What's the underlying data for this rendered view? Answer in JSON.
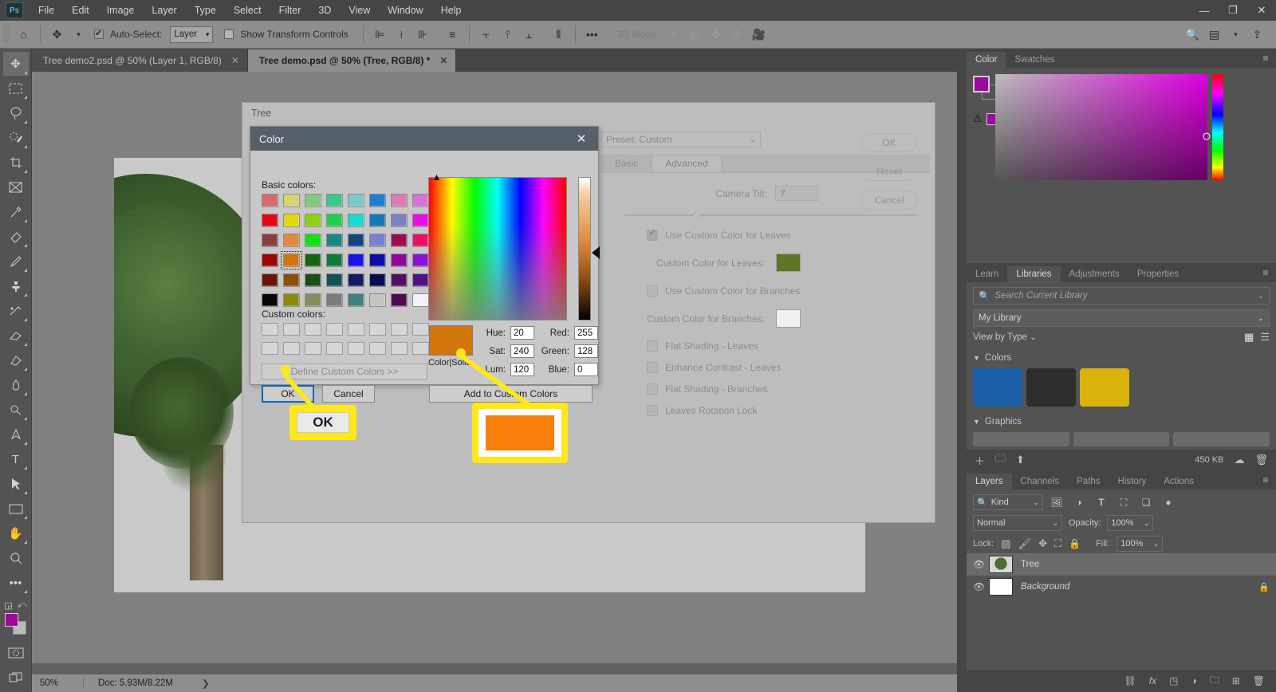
{
  "app": {
    "logo": "Ps",
    "menu": [
      "File",
      "Edit",
      "Image",
      "Layer",
      "Type",
      "Select",
      "Filter",
      "3D",
      "View",
      "Window",
      "Help"
    ],
    "window_controls": [
      "minimize-icon",
      "restore-icon",
      "close-icon"
    ]
  },
  "options_bar": {
    "home_icon": "home-icon",
    "move_tool_icon": "move-tool-icon",
    "auto_select_label": "Auto-Select:",
    "auto_select_checked": true,
    "layer_select_value": "Layer",
    "show_transform_label": "Show Transform Controls",
    "show_transform_checked": false,
    "align_icons": [
      "align-left-icon",
      "align-center-horizontal-icon",
      "align-right-icon",
      "distribute-horizontal-icon"
    ],
    "align_icons2": [
      "align-top-icon",
      "align-center-vertical-icon",
      "align-bottom-icon",
      "distribute-vertical-icon"
    ],
    "more_icon": "more-options-icon",
    "mode_3d_label": "3D Mode:",
    "mode_3d_icons": [
      "orbit-3d-icon",
      "roll-3d-icon",
      "pan-3d-icon",
      "slide-3d-icon",
      "camera-3d-icon"
    ],
    "right_icons": [
      "search-icon",
      "workspace-icon",
      "chevron-down-icon",
      "share-icon"
    ]
  },
  "tabs": [
    {
      "label": "Tree demo2.psd @ 50% (Layer 1, RGB/8)",
      "active": false,
      "close": "✕"
    },
    {
      "label": "Tree demo.psd @ 50% (Tree, RGB/8) *",
      "active": true,
      "close": "✕"
    }
  ],
  "toolbar": {
    "tools": [
      "move-tool-icon",
      "marquee-tool-icon",
      "lasso-tool-icon",
      "quick-select-tool-icon",
      "crop-tool-icon",
      "frame-tool-icon",
      "eyedropper-tool-icon",
      "healing-brush-tool-icon",
      "brush-tool-icon",
      "clone-stamp-tool-icon",
      "history-brush-tool-icon",
      "eraser-tool-icon",
      "gradient-tool-icon",
      "blur-tool-icon",
      "dodge-tool-icon",
      "pen-tool-icon",
      "type-tool-icon",
      "path-selection-tool-icon",
      "shape-tool-icon",
      "hand-tool-icon",
      "zoom-tool-icon",
      "edit-toolbar-icon"
    ],
    "default_colors_icon": "default-colors-icon",
    "swap_colors_icon": "swap-colors-icon",
    "foreground_color": "#9c079c",
    "background_color": "#b9b9b9",
    "quickmask_icon": "quick-mask-icon",
    "screenmode_icon": "screen-mode-icon"
  },
  "status_bar": {
    "zoom": "50%",
    "doc_info": "Doc: 5.93M/8.22M",
    "arrow": "❯"
  },
  "tree_dialog": {
    "title": "Tree",
    "preset_label": "Preset:",
    "preset_value": "Preset: Custom",
    "tabs": [
      {
        "label": "Basic",
        "active": false
      },
      {
        "label": "Advanced",
        "active": true
      }
    ],
    "camera_tilt_label": "Camera Tilt:",
    "camera_tilt_value": "7",
    "checkboxes": [
      {
        "label": "Use Custom Color for Leaves",
        "checked": true
      },
      {
        "label": "Use Custom Color for Branches",
        "checked": false
      },
      {
        "label": "Flat Shading - Leaves",
        "checked": false
      },
      {
        "label": "Enhance Contrast - Leaves",
        "checked": false
      },
      {
        "label": "Flat Shading - Branches",
        "checked": false
      },
      {
        "label": "Leaves Rotation Lock",
        "checked": false
      }
    ],
    "leaves_color_label": "Custom Color for Leaves:",
    "leaves_color": "#5e7527",
    "branches_color_label": "Custom Color for Branches:",
    "branches_color": "#f0f0f0",
    "buttons": [
      "OK",
      "Reset",
      "Cancel"
    ]
  },
  "color_dialog": {
    "title": "Color",
    "close_icon": "close-icon",
    "basic_colors_label": "Basic colors:",
    "custom_colors_label": "Custom colors:",
    "define_custom_label": "Define Custom Colors >>",
    "ok_label": "OK",
    "cancel_label": "Cancel",
    "add_custom_label": "Add to Custom Colors",
    "color_solid_label": "Color|Solid",
    "current_color": "#d2750d",
    "selected_swatch_index": 25,
    "basic_colors": [
      "#d76a6a",
      "#d9d173",
      "#83c87f",
      "#38c98c",
      "#79c9cc",
      "#1d7fd1",
      "#dd7cb0",
      "#d772d8",
      "#e30713",
      "#e0d905",
      "#90d012",
      "#21ce4e",
      "#19d9d2",
      "#1577b8",
      "#7d7fc0",
      "#e90de5",
      "#86403e",
      "#e08a3d",
      "#14e014",
      "#1a8686",
      "#15447e",
      "#7b7fd3",
      "#9a0d4b",
      "#ea1165",
      "#9c0606",
      "#d2750d",
      "#116411",
      "#10793e",
      "#1a12e6",
      "#0d0dab",
      "#93069a",
      "#8c12d7",
      "#6b1504",
      "#8d4e0b",
      "#1d4d17",
      "#105351",
      "#141c64",
      "#0b0c50",
      "#520e60",
      "#4d1482",
      "#070707",
      "#8d8a0b",
      "#878a5a",
      "#7b7b7b",
      "#3f7f7f",
      "#c3c3c3",
      "#4a0b4f",
      "#f2f2f2"
    ],
    "custom_colors_count": 16,
    "hsl": [
      {
        "label": "Hue:",
        "value": "20"
      },
      {
        "label": "Sat:",
        "value": "240"
      },
      {
        "label": "Lum:",
        "value": "120"
      }
    ],
    "rgb": [
      {
        "label": "Red:",
        "value": "255"
      },
      {
        "label": "Green:",
        "value": "128"
      },
      {
        "label": "Blue:",
        "value": "0"
      }
    ]
  },
  "annotations": [
    {
      "name": "ok-callout",
      "text": "OK"
    },
    {
      "name": "color-swatch-callout",
      "color": "#f97f0b"
    }
  ],
  "right_panels": {
    "color_panel": {
      "tabs": [
        {
          "label": "Color",
          "active": true
        },
        {
          "label": "Swatches",
          "active": false
        }
      ],
      "menu_icon": "panel-menu-icon",
      "foreground": "#9c079c",
      "background": "#b9b9b9",
      "warning_icon": "out-of-gamut-warning-icon",
      "warning_color": "#9c079c"
    },
    "libraries_panel": {
      "tabs": [
        {
          "label": "Learn",
          "active": false
        },
        {
          "label": "Libraries",
          "active": true
        },
        {
          "label": "Adjustments",
          "active": false
        },
        {
          "label": "Properties",
          "active": false
        }
      ],
      "menu_icon": "panel-menu-icon",
      "search_placeholder": "Search Current Library",
      "search_icon": "search-icon",
      "library_value": "My Library",
      "view_by_label": "View by Type",
      "grid_view_icon": "grid-view-icon",
      "list_view_icon": "list-view-icon",
      "colors_section": "Colors",
      "colors": [
        "#1a5fa8",
        "#2e2e2e",
        "#dbb20b"
      ],
      "graphics_section": "Graphics",
      "footer": {
        "add_icon": "add-icon",
        "folder_icon": "new-group-icon",
        "upload_icon": "upload-icon",
        "size": "450 KB",
        "cloud_icon": "cloud-icon",
        "trash_icon": "delete-icon"
      }
    },
    "layers_panel": {
      "tabs": [
        {
          "label": "Layers",
          "active": true
        },
        {
          "label": "Channels",
          "active": false
        },
        {
          "label": "Paths",
          "active": false
        },
        {
          "label": "History",
          "active": false
        },
        {
          "label": "Actions",
          "active": false
        }
      ],
      "menu_icon": "panel-menu-icon",
      "filter_value": "Kind",
      "filter_icons": [
        "filter-image-icon",
        "filter-adjustment-icon",
        "filter-type-icon",
        "filter-shape-icon",
        "filter-smart-object-icon"
      ],
      "filter_toggle_icon": "filter-toggle-icon",
      "blend_mode": "Normal",
      "opacity_label": "Opacity:",
      "opacity_value": "100%",
      "lock_label": "Lock:",
      "lock_icons": [
        "lock-transparent-pixels-icon",
        "lock-image-pixels-icon",
        "lock-position-icon",
        "lock-artboard-icon",
        "lock-all-icon"
      ],
      "fill_label": "Fill:",
      "fill_value": "100%",
      "layers": [
        {
          "name": "Tree",
          "visible": true,
          "selected": true,
          "locked": false,
          "italic": false
        },
        {
          "name": "Background",
          "visible": true,
          "selected": false,
          "locked": true,
          "italic": true
        }
      ],
      "footer_icons": [
        "link-layers-icon",
        "layer-style-icon",
        "layer-mask-icon",
        "adjustment-layer-icon",
        "new-group-icon",
        "new-layer-icon",
        "delete-layer-icon"
      ]
    }
  }
}
